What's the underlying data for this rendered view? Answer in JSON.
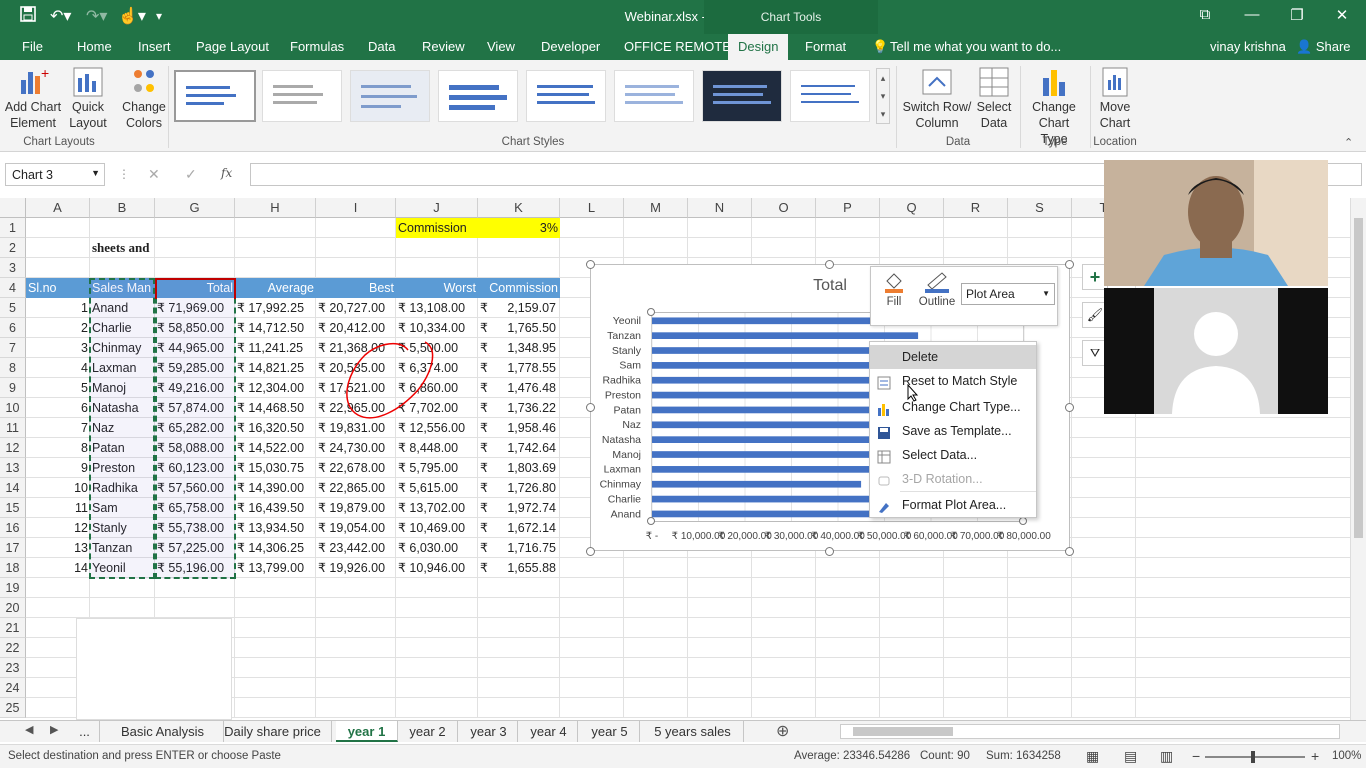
{
  "titlebar": {
    "title": "Webinar.xlsx - Excel",
    "chart_tools": "Chart Tools"
  },
  "menu": {
    "file": "File",
    "home": "Home",
    "insert": "Insert",
    "page_layout": "Page Layout",
    "formulas": "Formulas",
    "data": "Data",
    "review": "Review",
    "view": "View",
    "developer": "Developer",
    "office_remote": "OFFICE REMOTE",
    "design": "Design",
    "format": "Format",
    "tell_me": "Tell me what you want to do...",
    "user": "vinay krishna",
    "share": "Share"
  },
  "ribbon": {
    "add_chart_element": "Add Chart\nElement",
    "quick_layout": "Quick\nLayout",
    "change_colors": "Change\nColors",
    "switch_row_column": "Switch Row/\nColumn",
    "select_data": "Select\nData",
    "change_chart_type": "Change\nChart Type",
    "move_chart": "Move\nChart",
    "group_chart_layouts": "Chart Layouts",
    "group_chart_styles": "Chart Styles",
    "group_data": "Data",
    "group_type": "Type",
    "group_location": "Location"
  },
  "formula_bar": {
    "name_box": "Chart 3",
    "fx": "fx"
  },
  "columns": [
    "A",
    "B",
    "G",
    "H",
    "I",
    "J",
    "K",
    "L",
    "M",
    "N",
    "O",
    "P",
    "Q",
    "R",
    "S",
    "T"
  ],
  "rows": [
    "1",
    "2",
    "3",
    "4",
    "5",
    "6",
    "7",
    "8",
    "9",
    "10",
    "11",
    "12",
    "13",
    "14",
    "15",
    "16",
    "17",
    "18",
    "19",
    "20",
    "21",
    "22",
    "23",
    "24",
    "25"
  ],
  "sheet": {
    "commission_label": "Commission",
    "commission_value": "3%",
    "b2": "sheets and",
    "headers": [
      "Sl.no",
      "Sales Man",
      "Total",
      "Average",
      "Best",
      "Worst",
      "Commission"
    ],
    "data": [
      [
        "1",
        "Anand",
        "₹ 71,969.00",
        "₹ 17,992.25",
        "₹ 20,727.00",
        "₹ 13,108.00",
        "₹",
        "2,159.07"
      ],
      [
        "2",
        "Charlie",
        "₹ 58,850.00",
        "₹ 14,712.50",
        "₹ 20,412.00",
        "₹ 10,334.00",
        "₹",
        "1,765.50"
      ],
      [
        "3",
        "Chinmay",
        "₹ 44,965.00",
        "₹ 11,241.25",
        "₹ 21,368.00",
        "₹ 5,500.00",
        "₹",
        "1,348.95"
      ],
      [
        "4",
        "Laxman",
        "₹ 59,285.00",
        "₹ 14,821.25",
        "₹ 20,535.00",
        "₹ 6,374.00",
        "₹",
        "1,778.55"
      ],
      [
        "5",
        "Manoj",
        "₹ 49,216.00",
        "₹ 12,304.00",
        "₹ 17,521.00",
        "₹ 6,860.00",
        "₹",
        "1,476.48"
      ],
      [
        "6",
        "Natasha",
        "₹ 57,874.00",
        "₹ 14,468.50",
        "₹ 22,965.00",
        "₹ 7,702.00",
        "₹",
        "1,736.22"
      ],
      [
        "7",
        "Naz",
        "₹ 65,282.00",
        "₹ 16,320.50",
        "₹ 19,831.00",
        "₹ 12,556.00",
        "₹",
        "1,958.46"
      ],
      [
        "8",
        "Patan",
        "₹ 58,088.00",
        "₹ 14,522.00",
        "₹ 24,730.00",
        "₹ 8,448.00",
        "₹",
        "1,742.64"
      ],
      [
        "9",
        "Preston",
        "₹ 60,123.00",
        "₹ 15,030.75",
        "₹ 22,678.00",
        "₹ 5,795.00",
        "₹",
        "1,803.69"
      ],
      [
        "10",
        "Radhika",
        "₹ 57,560.00",
        "₹ 14,390.00",
        "₹ 22,865.00",
        "₹ 5,615.00",
        "₹",
        "1,726.80"
      ],
      [
        "11",
        "Sam",
        "₹ 65,758.00",
        "₹ 16,439.50",
        "₹ 19,879.00",
        "₹ 13,702.00",
        "₹",
        "1,972.74"
      ],
      [
        "12",
        "Stanly",
        "₹ 55,738.00",
        "₹ 13,934.50",
        "₹ 19,054.00",
        "₹ 10,469.00",
        "₹",
        "1,672.14"
      ],
      [
        "13",
        "Tanzan",
        "₹ 57,225.00",
        "₹ 14,306.25",
        "₹ 23,442.00",
        "₹ 6,030.00",
        "₹",
        "1,716.75"
      ],
      [
        "14",
        "Yeonil",
        "₹ 55,196.00",
        "₹ 13,799.00",
        "₹ 19,926.00",
        "₹ 10,946.00",
        "₹",
        "1,655.88"
      ]
    ]
  },
  "chart": {
    "title": "Total",
    "categories": [
      "Yeonil",
      "Tanzan",
      "Stanly",
      "Sam",
      "Radhika",
      "Preston",
      "Patan",
      "Naz",
      "Natasha",
      "Manoj",
      "Laxman",
      "Chinmay",
      "Charlie",
      "Anand"
    ],
    "xticks": [
      "₹ -",
      "₹ 10,000.00",
      "₹ 20,000.00",
      "₹ 30,000.00",
      "₹ 40,000.00",
      "₹ 50,000.00",
      "₹ 60,000.00",
      "₹ 70,000.00",
      "₹ 80,000.00"
    ]
  },
  "chart_data": {
    "type": "bar",
    "title": "Total",
    "categories": [
      "Anand",
      "Charlie",
      "Chinmay",
      "Laxman",
      "Manoj",
      "Natasha",
      "Naz",
      "Patan",
      "Preston",
      "Radhika",
      "Sam",
      "Stanly",
      "Tanzan",
      "Yeonil"
    ],
    "values": [
      71969,
      58850,
      44965,
      59285,
      49216,
      57874,
      65282,
      58088,
      60123,
      57560,
      65758,
      55738,
      57225,
      55196
    ],
    "xlim": [
      0,
      80000
    ],
    "orientation": "horizontal",
    "color": "#4472c4"
  },
  "mini_toolbar": {
    "fill": "Fill",
    "outline": "Outline",
    "element": "Plot Area"
  },
  "context_menu": {
    "delete": "Delete",
    "reset": "Reset to Match Style",
    "change_type": "Change Chart Type...",
    "save_template": "Save as Template...",
    "select_data": "Select Data...",
    "rotation": "3-D Rotation...",
    "format_plot": "Format Plot Area..."
  },
  "sheet_tabs": [
    "...",
    "Basic Analysis",
    "Daily share price",
    "year 1",
    "year 2",
    "year 3",
    "year 4",
    "year 5",
    "5 years sales"
  ],
  "active_tab": "year 1",
  "status": {
    "message": "Select destination and press ENTER or choose Paste",
    "average": "Average: 23346.54286",
    "count": "Count: 90",
    "sum": "Sum: 1634258",
    "zoom": "100%"
  },
  "colors": {
    "excel_green": "#217346",
    "header_blue": "#5b9bd5",
    "commission_yellow": "#ffff00",
    "bar_blue": "#4472c4"
  }
}
